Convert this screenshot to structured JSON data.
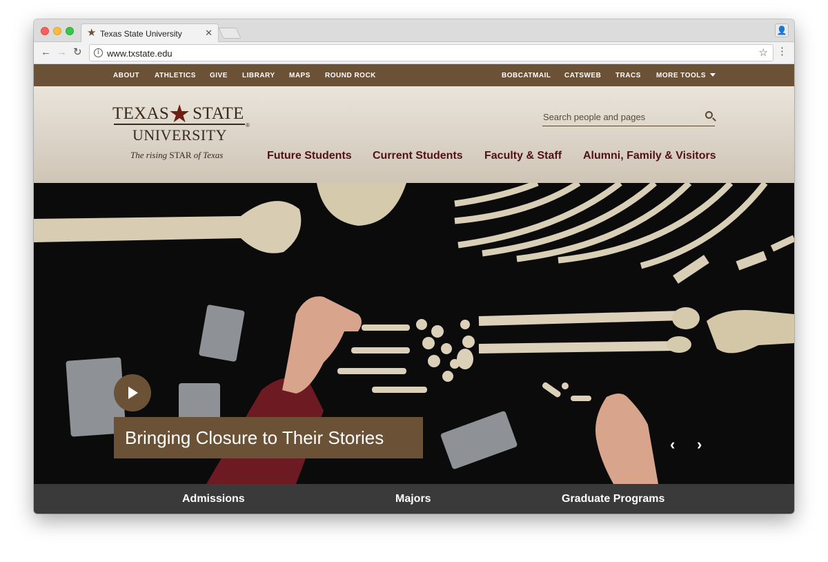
{
  "browser": {
    "tab_title": "Texas State University",
    "tab_favicon": "star-icon",
    "url": "www.txstate.edu"
  },
  "utility_nav": {
    "left": [
      "ABOUT",
      "ATHLETICS",
      "GIVE",
      "LIBRARY",
      "MAPS",
      "ROUND ROCK"
    ],
    "right": [
      "BOBCATMAIL",
      "CATSWEB",
      "TRACS",
      "MORE TOOLS"
    ]
  },
  "logo": {
    "line1_left": "TEXAS",
    "line1_right": "STATE",
    "line2": "UNIVERSITY",
    "tagline_italic1": "The rising",
    "tagline_star": "STAR",
    "tagline_italic2": "of Texas",
    "registered": "®"
  },
  "search": {
    "placeholder": "Search people and pages"
  },
  "main_nav": [
    "Future Students",
    "Current Students",
    "Faculty & Staff",
    "Alumni, Family & Visitors"
  ],
  "hero": {
    "caption": "Bringing Closure to Their Stories",
    "prev_glyph": "‹",
    "next_glyph": "›"
  },
  "bottom_links": [
    "Admissions",
    "Majors",
    "Graduate Programs"
  ],
  "colors": {
    "brand_gold_brown": "#6b5236",
    "maroon": "#501214",
    "header_bg": "#e9e4db"
  }
}
